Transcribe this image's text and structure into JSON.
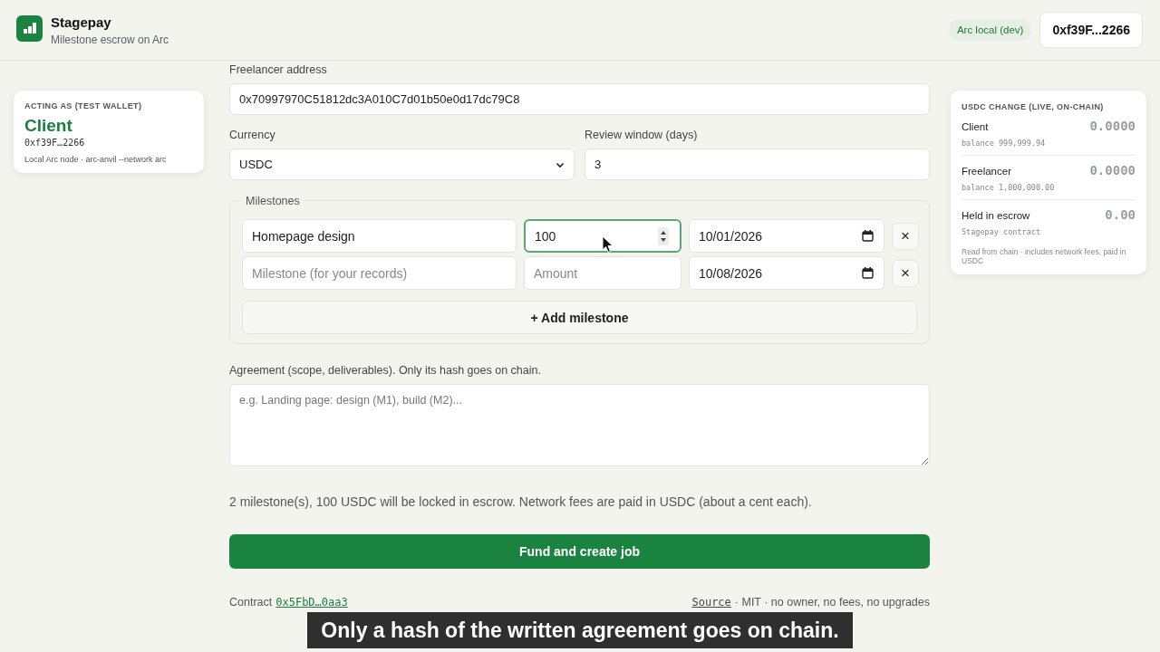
{
  "app": {
    "name": "Stagepay",
    "tagline": "Milestone escrow on Arc"
  },
  "header": {
    "network_badge": "Arc local (dev)",
    "wallet_button": "0xf39F...2266"
  },
  "role_card": {
    "heading": "ACTING AS (TEST WALLET)",
    "role": "Client",
    "address": "0xf39F…2266",
    "note": "Local Arc node · arc-anvil --network arc"
  },
  "form": {
    "freelancer": {
      "label": "Freelancer address",
      "value": "0x70997970C51812dc3A010C7d01b50e0d17dc79C8"
    },
    "currency": {
      "label": "Currency",
      "value": "USDC"
    },
    "review_window": {
      "label": "Review window (days)",
      "value": "3"
    },
    "milestones": {
      "legend": "Milestones",
      "rows": [
        {
          "title": {
            "value": "Homepage design"
          },
          "amount": {
            "value": "100",
            "focused": true
          },
          "date": "10/01/2026",
          "remove": "×"
        },
        {
          "title": {
            "placeholder": "Milestone (for your records)"
          },
          "amount": {
            "placeholder": "Amount",
            "focused": false
          },
          "date": "10/08/2026",
          "remove": "×"
        }
      ],
      "add_button": "+ Add milestone"
    },
    "agreement": {
      "label": "Agreement (scope, deliverables). Only its hash goes on chain.",
      "placeholder": "e.g. Landing page: design (M1), build (M2)..."
    },
    "summary": "2 milestone(s), 100 USDC will be locked in escrow. Network fees are paid in USDC (about a cent each).",
    "submit_button": "Fund and create job"
  },
  "footer": {
    "contract_label": "Contract",
    "contract_link": "0x5FbD…0aa3",
    "source_link": "Source",
    "license_note": "· MIT · no owner, no fees, no upgrades"
  },
  "balances_card": {
    "heading": "USDC CHANGE (LIVE, ON-CHAIN)",
    "rows": [
      {
        "name": "Client",
        "change": "0.0000",
        "detail": "balance 999,999.94"
      },
      {
        "name": "Freelancer",
        "change": "0.0000",
        "detail": "balance 1,000,000.00"
      },
      {
        "name": "Held in escrow",
        "change": "0.00",
        "detail": "Stagepay contract"
      }
    ],
    "note": "Read from chain · includes network fees, paid in USDC"
  },
  "caption": "Only a hash of the written agreement goes on chain."
}
